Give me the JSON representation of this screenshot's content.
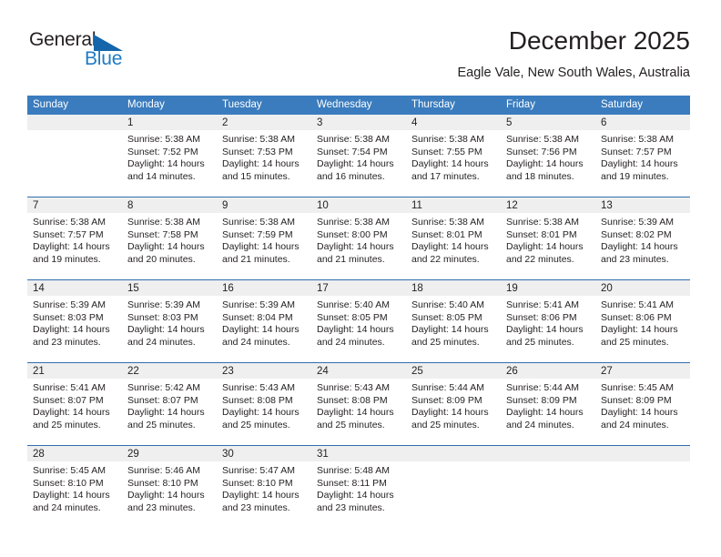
{
  "brand": {
    "word_one": "General",
    "word_two": "Blue",
    "logo_icon": "blue-triangle-icon",
    "accent_color": "#1566ab",
    "blue_text_color": "#1f7ac4"
  },
  "header": {
    "month_title": "December 2025",
    "location": "Eagle Vale, New South Wales, Australia"
  },
  "calendar": {
    "header_bg": "#3a7cbe",
    "header_text_color": "#ffffff",
    "daynum_band_bg": "#efefef",
    "week_divider_color": "#2f6fb0",
    "weekday_headers": [
      "Sunday",
      "Monday",
      "Tuesday",
      "Wednesday",
      "Thursday",
      "Friday",
      "Saturday"
    ],
    "weeks": [
      [
        {
          "day": "",
          "blank": true,
          "sunrise": "",
          "sunset": "",
          "daylight_line1": "",
          "daylight_line2": ""
        },
        {
          "day": "1",
          "blank": false,
          "sunrise": "Sunrise: 5:38 AM",
          "sunset": "Sunset: 7:52 PM",
          "daylight_line1": "Daylight: 14 hours",
          "daylight_line2": "and 14 minutes."
        },
        {
          "day": "2",
          "blank": false,
          "sunrise": "Sunrise: 5:38 AM",
          "sunset": "Sunset: 7:53 PM",
          "daylight_line1": "Daylight: 14 hours",
          "daylight_line2": "and 15 minutes."
        },
        {
          "day": "3",
          "blank": false,
          "sunrise": "Sunrise: 5:38 AM",
          "sunset": "Sunset: 7:54 PM",
          "daylight_line1": "Daylight: 14 hours",
          "daylight_line2": "and 16 minutes."
        },
        {
          "day": "4",
          "blank": false,
          "sunrise": "Sunrise: 5:38 AM",
          "sunset": "Sunset: 7:55 PM",
          "daylight_line1": "Daylight: 14 hours",
          "daylight_line2": "and 17 minutes."
        },
        {
          "day": "5",
          "blank": false,
          "sunrise": "Sunrise: 5:38 AM",
          "sunset": "Sunset: 7:56 PM",
          "daylight_line1": "Daylight: 14 hours",
          "daylight_line2": "and 18 minutes."
        },
        {
          "day": "6",
          "blank": false,
          "sunrise": "Sunrise: 5:38 AM",
          "sunset": "Sunset: 7:57 PM",
          "daylight_line1": "Daylight: 14 hours",
          "daylight_line2": "and 19 minutes."
        }
      ],
      [
        {
          "day": "7",
          "blank": false,
          "sunrise": "Sunrise: 5:38 AM",
          "sunset": "Sunset: 7:57 PM",
          "daylight_line1": "Daylight: 14 hours",
          "daylight_line2": "and 19 minutes."
        },
        {
          "day": "8",
          "blank": false,
          "sunrise": "Sunrise: 5:38 AM",
          "sunset": "Sunset: 7:58 PM",
          "daylight_line1": "Daylight: 14 hours",
          "daylight_line2": "and 20 minutes."
        },
        {
          "day": "9",
          "blank": false,
          "sunrise": "Sunrise: 5:38 AM",
          "sunset": "Sunset: 7:59 PM",
          "daylight_line1": "Daylight: 14 hours",
          "daylight_line2": "and 21 minutes."
        },
        {
          "day": "10",
          "blank": false,
          "sunrise": "Sunrise: 5:38 AM",
          "sunset": "Sunset: 8:00 PM",
          "daylight_line1": "Daylight: 14 hours",
          "daylight_line2": "and 21 minutes."
        },
        {
          "day": "11",
          "blank": false,
          "sunrise": "Sunrise: 5:38 AM",
          "sunset": "Sunset: 8:01 PM",
          "daylight_line1": "Daylight: 14 hours",
          "daylight_line2": "and 22 minutes."
        },
        {
          "day": "12",
          "blank": false,
          "sunrise": "Sunrise: 5:38 AM",
          "sunset": "Sunset: 8:01 PM",
          "daylight_line1": "Daylight: 14 hours",
          "daylight_line2": "and 22 minutes."
        },
        {
          "day": "13",
          "blank": false,
          "sunrise": "Sunrise: 5:39 AM",
          "sunset": "Sunset: 8:02 PM",
          "daylight_line1": "Daylight: 14 hours",
          "daylight_line2": "and 23 minutes."
        }
      ],
      [
        {
          "day": "14",
          "blank": false,
          "sunrise": "Sunrise: 5:39 AM",
          "sunset": "Sunset: 8:03 PM",
          "daylight_line1": "Daylight: 14 hours",
          "daylight_line2": "and 23 minutes."
        },
        {
          "day": "15",
          "blank": false,
          "sunrise": "Sunrise: 5:39 AM",
          "sunset": "Sunset: 8:03 PM",
          "daylight_line1": "Daylight: 14 hours",
          "daylight_line2": "and 24 minutes."
        },
        {
          "day": "16",
          "blank": false,
          "sunrise": "Sunrise: 5:39 AM",
          "sunset": "Sunset: 8:04 PM",
          "daylight_line1": "Daylight: 14 hours",
          "daylight_line2": "and 24 minutes."
        },
        {
          "day": "17",
          "blank": false,
          "sunrise": "Sunrise: 5:40 AM",
          "sunset": "Sunset: 8:05 PM",
          "daylight_line1": "Daylight: 14 hours",
          "daylight_line2": "and 24 minutes."
        },
        {
          "day": "18",
          "blank": false,
          "sunrise": "Sunrise: 5:40 AM",
          "sunset": "Sunset: 8:05 PM",
          "daylight_line1": "Daylight: 14 hours",
          "daylight_line2": "and 25 minutes."
        },
        {
          "day": "19",
          "blank": false,
          "sunrise": "Sunrise: 5:41 AM",
          "sunset": "Sunset: 8:06 PM",
          "daylight_line1": "Daylight: 14 hours",
          "daylight_line2": "and 25 minutes."
        },
        {
          "day": "20",
          "blank": false,
          "sunrise": "Sunrise: 5:41 AM",
          "sunset": "Sunset: 8:06 PM",
          "daylight_line1": "Daylight: 14 hours",
          "daylight_line2": "and 25 minutes."
        }
      ],
      [
        {
          "day": "21",
          "blank": false,
          "sunrise": "Sunrise: 5:41 AM",
          "sunset": "Sunset: 8:07 PM",
          "daylight_line1": "Daylight: 14 hours",
          "daylight_line2": "and 25 minutes."
        },
        {
          "day": "22",
          "blank": false,
          "sunrise": "Sunrise: 5:42 AM",
          "sunset": "Sunset: 8:07 PM",
          "daylight_line1": "Daylight: 14 hours",
          "daylight_line2": "and 25 minutes."
        },
        {
          "day": "23",
          "blank": false,
          "sunrise": "Sunrise: 5:43 AM",
          "sunset": "Sunset: 8:08 PM",
          "daylight_line1": "Daylight: 14 hours",
          "daylight_line2": "and 25 minutes."
        },
        {
          "day": "24",
          "blank": false,
          "sunrise": "Sunrise: 5:43 AM",
          "sunset": "Sunset: 8:08 PM",
          "daylight_line1": "Daylight: 14 hours",
          "daylight_line2": "and 25 minutes."
        },
        {
          "day": "25",
          "blank": false,
          "sunrise": "Sunrise: 5:44 AM",
          "sunset": "Sunset: 8:09 PM",
          "daylight_line1": "Daylight: 14 hours",
          "daylight_line2": "and 25 minutes."
        },
        {
          "day": "26",
          "blank": false,
          "sunrise": "Sunrise: 5:44 AM",
          "sunset": "Sunset: 8:09 PM",
          "daylight_line1": "Daylight: 14 hours",
          "daylight_line2": "and 24 minutes."
        },
        {
          "day": "27",
          "blank": false,
          "sunrise": "Sunrise: 5:45 AM",
          "sunset": "Sunset: 8:09 PM",
          "daylight_line1": "Daylight: 14 hours",
          "daylight_line2": "and 24 minutes."
        }
      ],
      [
        {
          "day": "28",
          "blank": false,
          "sunrise": "Sunrise: 5:45 AM",
          "sunset": "Sunset: 8:10 PM",
          "daylight_line1": "Daylight: 14 hours",
          "daylight_line2": "and 24 minutes."
        },
        {
          "day": "29",
          "blank": false,
          "sunrise": "Sunrise: 5:46 AM",
          "sunset": "Sunset: 8:10 PM",
          "daylight_line1": "Daylight: 14 hours",
          "daylight_line2": "and 23 minutes."
        },
        {
          "day": "30",
          "blank": false,
          "sunrise": "Sunrise: 5:47 AM",
          "sunset": "Sunset: 8:10 PM",
          "daylight_line1": "Daylight: 14 hours",
          "daylight_line2": "and 23 minutes."
        },
        {
          "day": "31",
          "blank": false,
          "sunrise": "Sunrise: 5:48 AM",
          "sunset": "Sunset: 8:11 PM",
          "daylight_line1": "Daylight: 14 hours",
          "daylight_line2": "and 23 minutes."
        },
        {
          "day": "",
          "blank": true,
          "sunrise": "",
          "sunset": "",
          "daylight_line1": "",
          "daylight_line2": ""
        },
        {
          "day": "",
          "blank": true,
          "sunrise": "",
          "sunset": "",
          "daylight_line1": "",
          "daylight_line2": ""
        },
        {
          "day": "",
          "blank": true,
          "sunrise": "",
          "sunset": "",
          "daylight_line1": "",
          "daylight_line2": ""
        }
      ]
    ]
  }
}
